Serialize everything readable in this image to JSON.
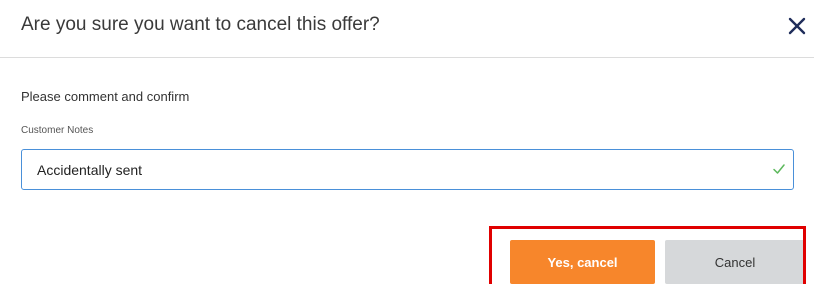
{
  "dialog": {
    "title": "Are you sure you want to cancel this offer?",
    "close_icon": "close-icon"
  },
  "form": {
    "instruction": "Please comment and confirm",
    "notes_label": "Customer Notes",
    "notes_value": "Accidentally sent",
    "notes_valid_icon": "check-icon"
  },
  "actions": {
    "confirm_label": "Yes, cancel",
    "cancel_label": "Cancel"
  },
  "colors": {
    "confirm_bg": "#f7862b",
    "cancel_bg": "#d6d8da",
    "input_border": "#4a90d9",
    "valid_check": "#5cb85c",
    "highlight": "#e00000"
  }
}
